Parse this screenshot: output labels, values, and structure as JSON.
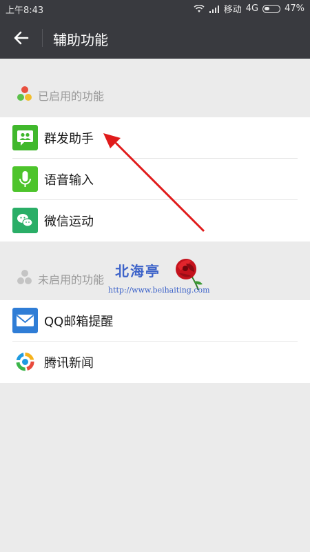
{
  "status_bar": {
    "time": "上午8:43",
    "carrier": "移动",
    "network": "4G",
    "battery": "47%"
  },
  "app_bar": {
    "title": "辅助功能"
  },
  "sections": {
    "enabled": {
      "label": "已启用的功能",
      "items": [
        {
          "label": "群发助手",
          "icon": "mass-message-icon",
          "color": "#40b82c"
        },
        {
          "label": "语音输入",
          "icon": "microphone-icon",
          "color": "#4dc42b"
        },
        {
          "label": "微信运动",
          "icon": "wechat-sport-icon",
          "color": "#2aae67"
        }
      ]
    },
    "disabled": {
      "label": "未启用的功能",
      "items": [
        {
          "label": "QQ邮箱提醒",
          "icon": "mail-icon",
          "color": "#2f7dd6"
        },
        {
          "label": "腾讯新闻",
          "icon": "tencent-news-icon",
          "color": "#1f9be0"
        }
      ]
    }
  },
  "watermark": {
    "name": "北海亭",
    "url": "http://www.beihaiting.com"
  },
  "colors": {
    "app_bar": "#393a3f",
    "background": "#ebebeb",
    "arrow": "#e01b1b"
  }
}
